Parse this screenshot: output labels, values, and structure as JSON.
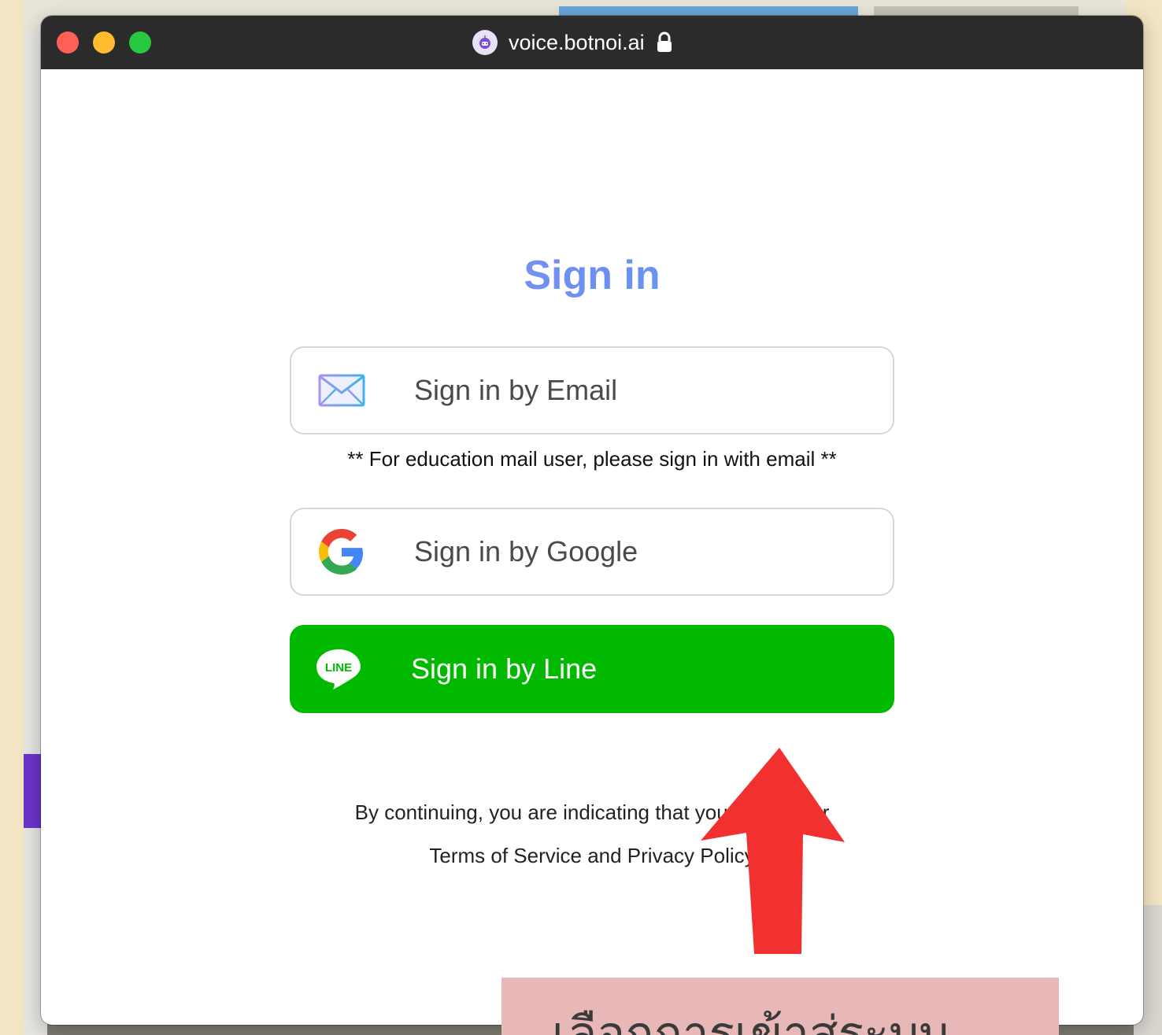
{
  "browser": {
    "url": "voice.botnoi.ai",
    "site_icon": "robot-icon",
    "lock_icon": "lock-icon"
  },
  "signin": {
    "heading": "Sign in",
    "email_button": "Sign in by Email",
    "education_note": "** For education mail user, please sign in with email **",
    "google_button": "Sign in by Google",
    "line_button": "Sign in by Line",
    "line_logo_text": "LINE",
    "terms_line1": "By continuing, you are indicating that you accept our",
    "terms_line2": "Terms of Service and Privacy Policy"
  },
  "annotation": {
    "callout_text": "เลือกการเข้าสู่ระบบ",
    "arrow_color": "#f23030"
  },
  "colors": {
    "line_green": "#00b900",
    "heading_gradient_start": "#a394f2",
    "heading_gradient_end": "#25b8ea",
    "callout_bg": "#e8b7b7"
  }
}
